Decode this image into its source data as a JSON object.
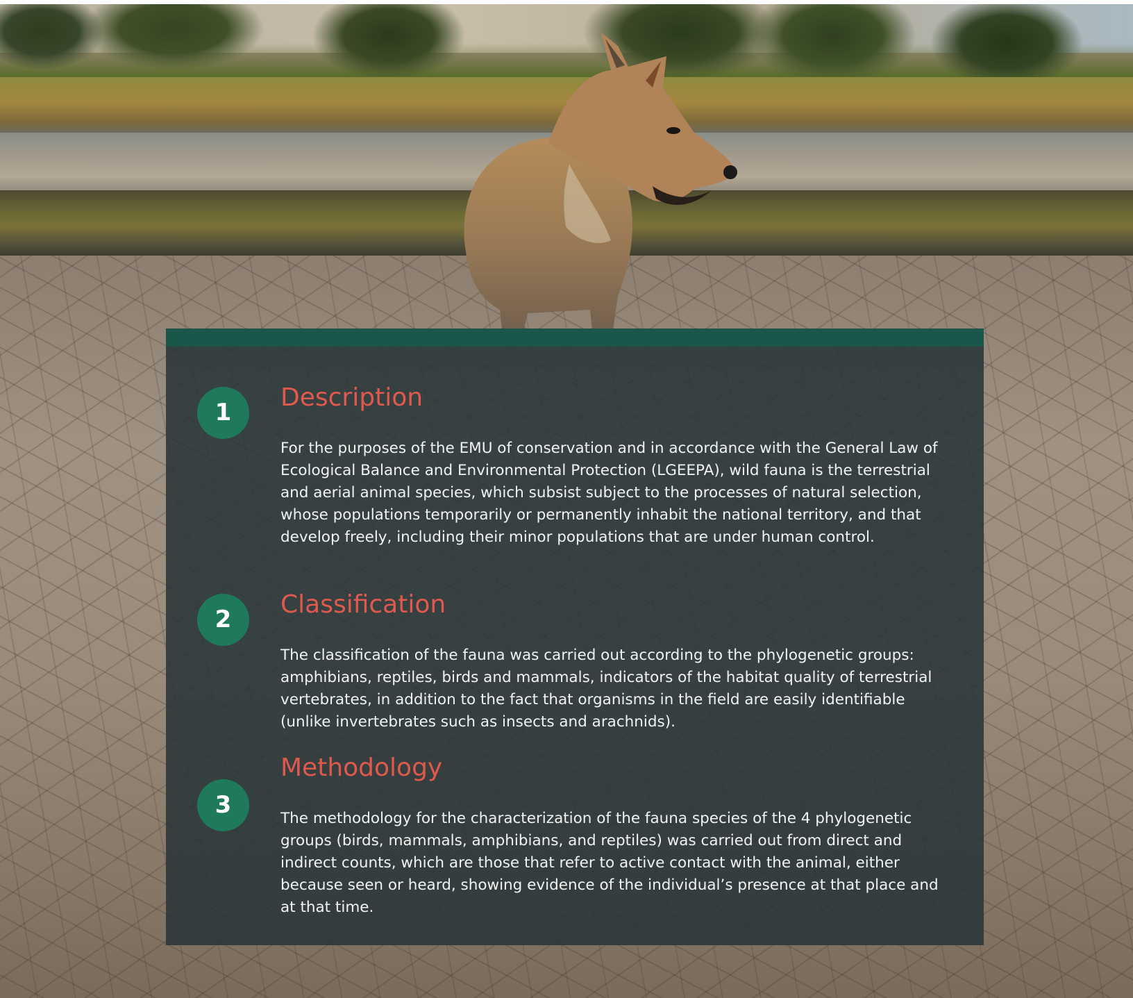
{
  "background": {
    "subject": "coyote-photo"
  },
  "colors": {
    "accent_bar": "#1b564a",
    "badge": "#1e7a5a",
    "title": "#e0594d",
    "panel": "#283438",
    "body_text": "#f2f2f2"
  },
  "sections": [
    {
      "number": "1",
      "title": "Description",
      "body": "For the purposes of the EMU of conservation and in accordance with the General Law of Ecological Balance and Environmental Protection (LGEEPA), wild fauna is the terrestrial and aerial animal species, which subsist subject to the processes of natural selection, whose populations temporarily or permanently inhabit the national territory, and that develop freely, including their minor populations that are under human control."
    },
    {
      "number": "2",
      "title": "Classification",
      "body": "The classification of the fauna was carried out according to the phylogenetic groups: amphibians, reptiles, birds and mammals, indicators of the habitat quality of terrestrial vertebrates, in addition to the fact that organisms in the field are easily identifiable (unlike invertebrates such as insects and arachnids)."
    },
    {
      "number": "3",
      "title": "Methodology",
      "body": "The methodology for the characterization of the fauna species of the 4 phylogenetic groups (birds, mammals, amphibians, and reptiles) was carried out from direct and indirect counts, which are those that refer to active contact with the animal, either because seen or heard, showing evidence of the individual’s presence at that place and at that time."
    }
  ]
}
